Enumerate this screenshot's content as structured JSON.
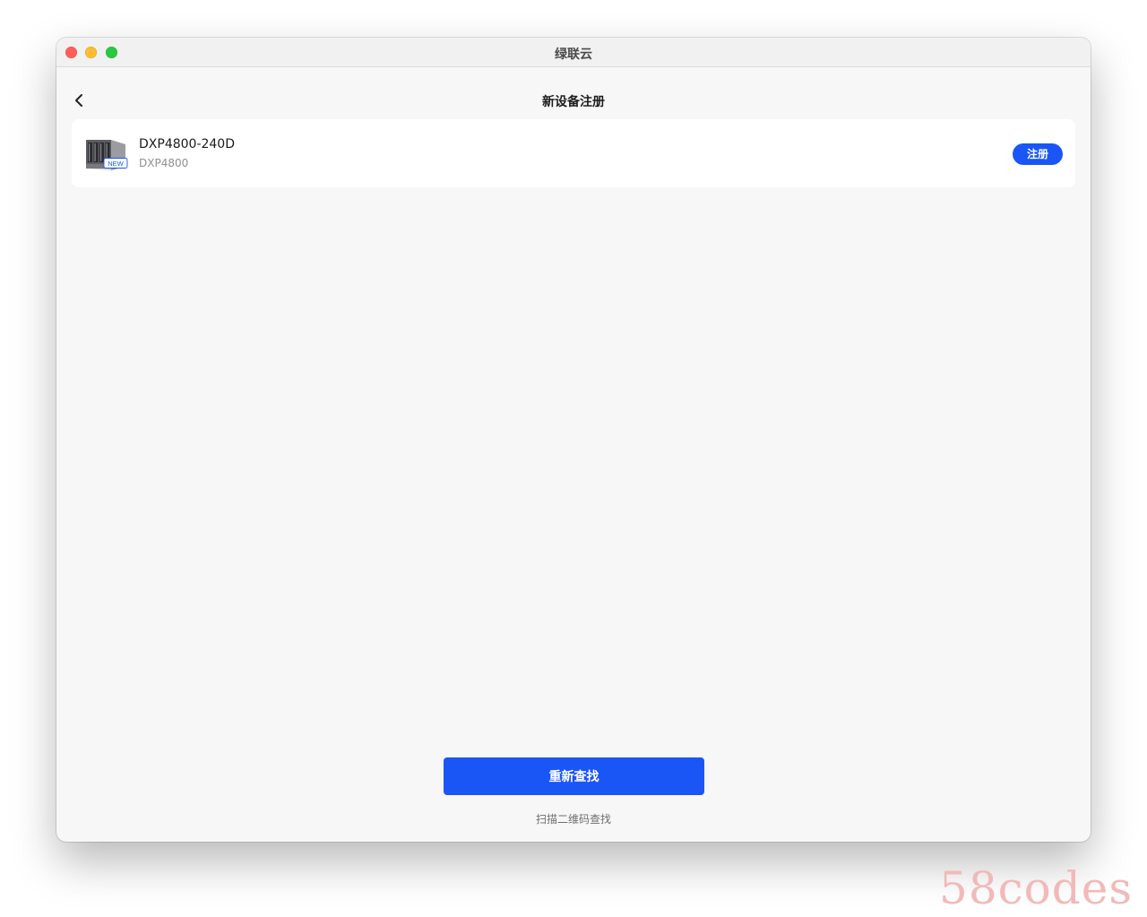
{
  "window": {
    "title": "绿联云"
  },
  "header": {
    "back_icon": "chevron-left-icon",
    "title": "新设备注册"
  },
  "device": {
    "image_icon": "nas-device-icon",
    "badge": "NEW",
    "name": "DXP4800-240D",
    "model": "DXP4800",
    "register_label": "注册"
  },
  "footer": {
    "rescan_label": "重新查找",
    "scan_qr_label": "扫描二维码查找"
  },
  "watermark": {
    "text": "58codes"
  },
  "colors": {
    "accent": "#1a56f5",
    "window_bg": "#f7f7f7",
    "card_bg": "#ffffff",
    "close": "#fe5f57",
    "minimize": "#febc2e",
    "maximize": "#28c840"
  }
}
